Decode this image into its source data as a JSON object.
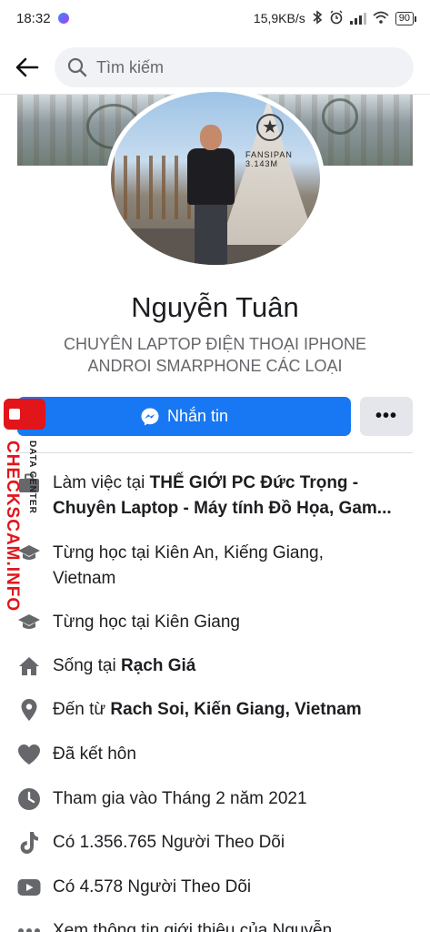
{
  "status_bar": {
    "time": "18:32",
    "network_speed": "15,9KB/s",
    "battery": "90"
  },
  "search": {
    "placeholder": "Tìm kiếm"
  },
  "profile": {
    "name": "Nguyễn Tuân",
    "bio_line1": "CHUYÊN LAPTOP ĐIỆN THOẠI IPHONE",
    "bio_line2": "ANDROI SMARPHONE CÁC LOẠI",
    "avatar_sign_text": "FANSIPAN 3.143M"
  },
  "actions": {
    "message_label": "Nhắn tin",
    "more_label": "•••"
  },
  "watermark": {
    "main": "CHECKSCAM.INFO",
    "sub": "DATA CENTER"
  },
  "info": {
    "work_prefix": "Làm việc tại ",
    "work_line1_bold": "THẾ GIỚI PC Đức Trọng -",
    "work_line2_bold": "Chuyên Laptop - Máy tính Đồ Họa, Gam...",
    "study1_line1": "Từng học tại Kiên An, Kiếng Giang,",
    "study1_line2": "Vietnam",
    "study2": "Từng học tại Kiên Giang",
    "lives_prefix": "Sống tại ",
    "lives_bold": "Rạch Giá",
    "from_prefix": "Đến từ ",
    "from_bold": "Rach Soi, Kiến Giang, Vietnam",
    "relationship": "Đã kết hôn",
    "joined": "Tham gia vào Tháng 2 năm 2021",
    "tiktok_followers": "Có 1.356.765 Người Theo Dõi",
    "youtube_followers": "Có 4.578 Người Theo Dõi",
    "see_more": "Xem thông tin giới thiệu của Nguyễn"
  },
  "icons": {
    "work": "briefcase-icon",
    "study": "graduation-cap-icon",
    "home": "home-icon",
    "location": "location-pin-icon",
    "relationship": "heart-icon",
    "joined": "clock-icon",
    "tiktok": "tiktok-icon",
    "youtube": "youtube-icon",
    "more": "more-dots-icon"
  },
  "colors": {
    "accent": "#1877f2",
    "icon_gray": "#65676b",
    "watermark_red": "#e2151b"
  }
}
